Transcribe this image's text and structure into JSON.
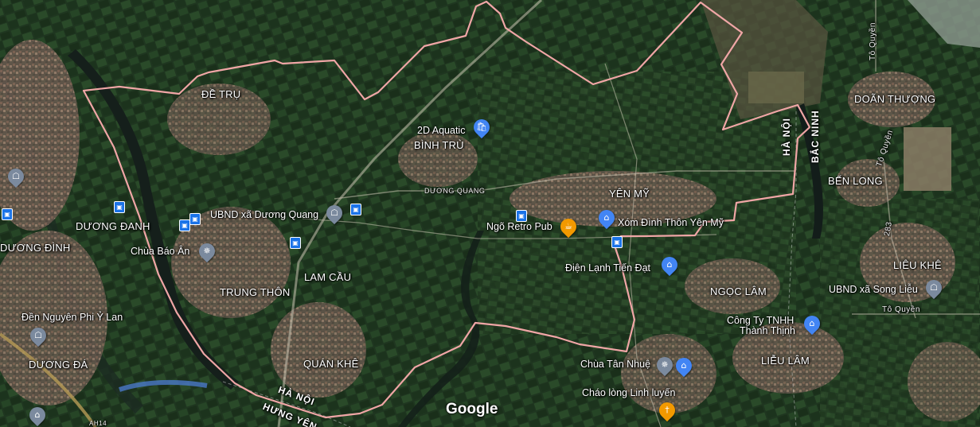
{
  "map": {
    "places": {
      "de_tru": "ĐỀ TRỤ",
      "doan_thuong": "DOÃN THƯỢNG",
      "binh_tru": "BÌNH TRÙ",
      "yen_my": "YÊN MỸ",
      "ben_long": "BẾN LONG",
      "duong_danh": "DƯƠNG ĐANH",
      "duong_dinh": "DƯƠNG ĐÌNH",
      "trung_thon": "TRUNG THÔN",
      "lam_cau": "LAM CẦU",
      "lieu_khe": "LIÊU KHÊ",
      "ngoc_lam": "NGỌC LÂM",
      "lieu_lam": "LIỄU LÂM",
      "duong_da": "DƯƠNG ĐÁ",
      "quan_khe": "QUÁN KHÊ"
    },
    "pois": {
      "aquatic": "2D Aquatic",
      "ubnd_duong_quang": "UBND xã Dương Quang",
      "ngo_retro": "Ngõ Retro Pub",
      "xom_dinh": "Xóm Đình Thôn Yên Mỹ",
      "dien_lanh": "Điện Lạnh Tiến Đạt",
      "chua_bao_an": "Chùa Báo Ân",
      "den_nguyen": "Đền Nguyên Phi Ỷ Lan",
      "ubnd_song_lieu": "UBND xã Song Liễu",
      "cong_ty": "Công Ty TNHH",
      "thanh_thinh": "Thành Thịnh",
      "chua_tan_nhue": "Chùa Tân Nhuệ",
      "chao_long": "Cháo lòng Linh luyến"
    },
    "roads": {
      "duong_quang": "DƯƠNG QUANG",
      "to_quyen": "Tô Quyền",
      "r283": "283",
      "ah14": "AH14"
    },
    "admin": {
      "ha_noi": "HÀ NỘI",
      "bac_ninh": "BẮC NINH",
      "hung_yen": "HƯNG YÊN"
    },
    "attribution": "Google",
    "colors": {
      "boundary": "#e8a0a0",
      "pin_blue": "#4285f4",
      "pin_orange": "#f29900",
      "pin_gray": "#7b8a9e",
      "bus_blue": "#1a73e8"
    },
    "icons": [
      "shopping-bag-pin-icon",
      "government-building-pin-icon",
      "bus-stop-icon",
      "bar-pin-icon",
      "temple-pin-icon",
      "restaurant-pin-icon",
      "school-pin-icon"
    ]
  }
}
